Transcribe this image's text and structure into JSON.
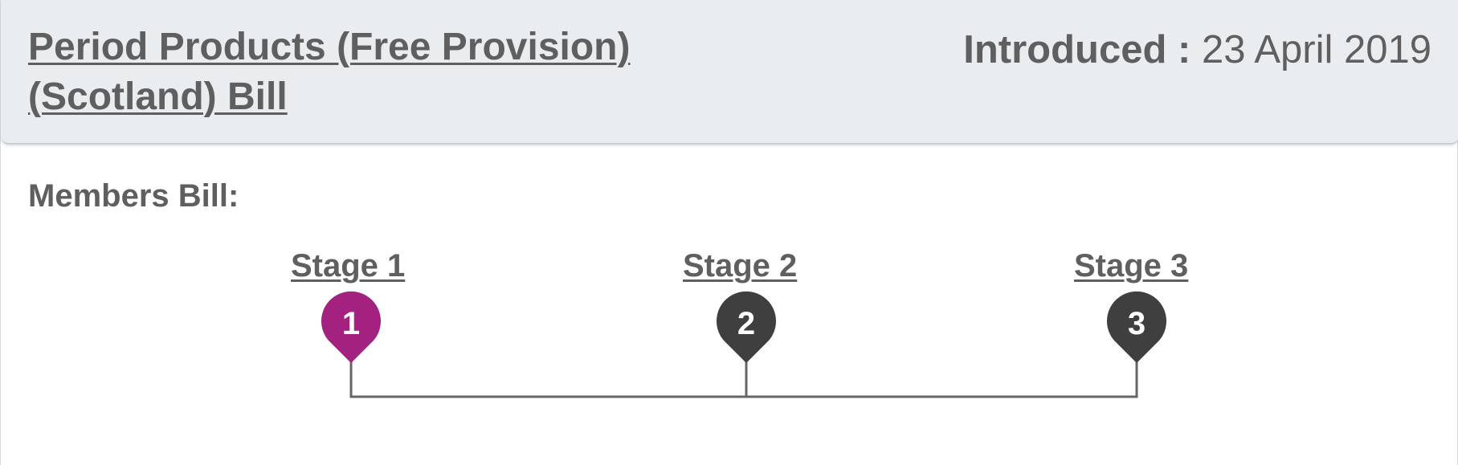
{
  "bill": {
    "title": "Period Products (Free Provision) (Scotland) Bill",
    "introduced_label": "Introduced : ",
    "introduced_date": "23 April 2019"
  },
  "bill_type_label": "Members Bill:",
  "stages": [
    {
      "label": "Stage 1",
      "number": "1",
      "status": "current",
      "color": "#a3217f"
    },
    {
      "label": "Stage 2",
      "number": "2",
      "status": "pending",
      "color": "#3f3f3f"
    },
    {
      "label": "Stage 3",
      "number": "3",
      "status": "pending",
      "color": "#3f3f3f"
    }
  ],
  "colors": {
    "header_bg": "#e9edf0",
    "text": "#5f5f5f",
    "active_stage": "#a3217f",
    "inactive_stage": "#3f3f3f",
    "timeline": "#666666"
  }
}
